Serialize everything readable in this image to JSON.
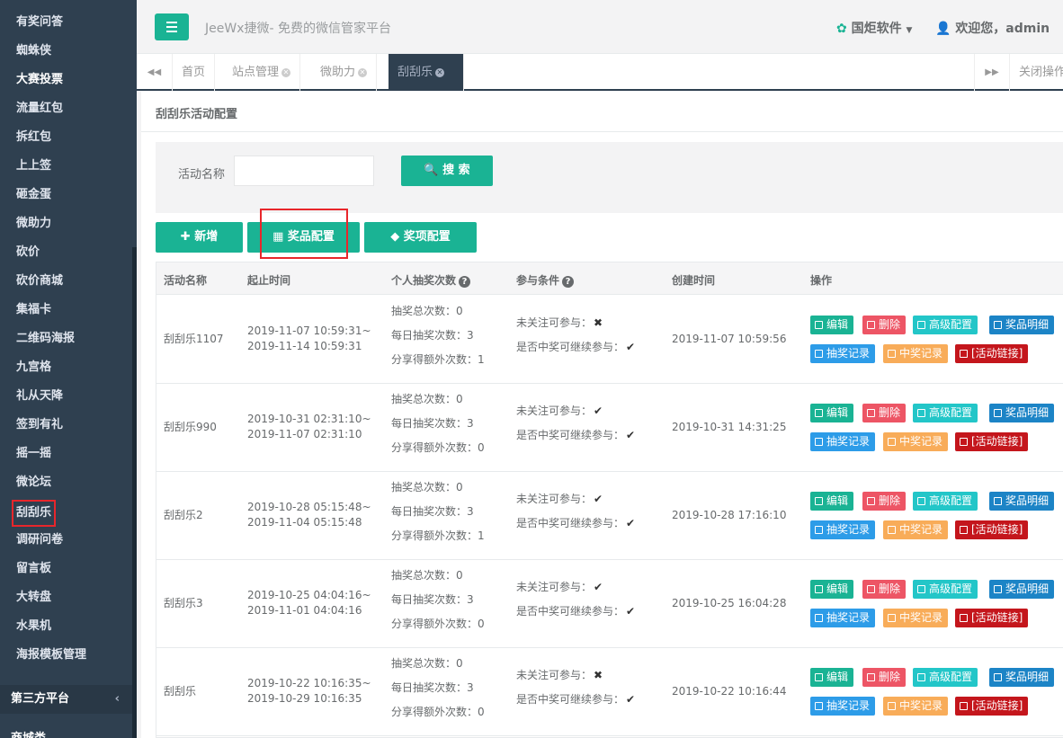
{
  "sidebar": {
    "items": [
      "有奖问答",
      "蜘蛛侠",
      "大赛投票",
      "流量红包",
      "拆红包",
      "上上签",
      "砸金蛋",
      "微助力",
      "砍价",
      "砍价商城",
      "集福卡",
      "二维码海报",
      "九宫格",
      "礼从天降",
      "签到有礼",
      "摇一摇",
      "微论坛",
      "刮刮乐",
      "调研问卷",
      "留言板",
      "大转盘",
      "水果机",
      "海报模板管理"
    ],
    "group_label": "第三方平台",
    "group_caret": "‹",
    "next_group_label": "商城类"
  },
  "header": {
    "brand": "JeeWx捷微- 免费的微信管家平台",
    "company": "国炬软件",
    "welcome": "欢迎您，admin"
  },
  "tabs": {
    "home": "首页",
    "site": "站点管理",
    "help": "微助力",
    "scratch": "刮刮乐",
    "close_ops": "关闭操作",
    "nav_left": "◀◀",
    "nav_right": "▶▶"
  },
  "page": {
    "title": "刮刮乐活动配置",
    "search_label": "活动名称",
    "search_value": "",
    "search_button": "搜 索",
    "add_button": "新增",
    "prize_config_button": "奖品配置",
    "award_config_button": "奖项配置"
  },
  "table": {
    "headers": [
      "活动名称",
      "起止时间",
      "个人抽奖次数",
      "参与条件",
      "创建时间",
      "操作"
    ],
    "op_labels": [
      "编辑",
      "删除",
      "高级配置",
      "奖品明细",
      "抽奖记录",
      "中奖记录",
      "[活动链接]"
    ],
    "rows": [
      {
        "name": "刮刮乐1107",
        "start": "2019-11-07 10:59:31~",
        "end": "2019-11-14 10:59:31",
        "total": "抽奖总次数：0",
        "daily": "每日抽奖次数：3",
        "share": "分享得额外次数：1",
        "follow": "未关注可参与：",
        "follow_mark": "✖",
        "cont": "是否中奖可继续参与：",
        "cont_mark": "✔",
        "created": "2019-11-07 10:59:56"
      },
      {
        "name": "刮刮乐990",
        "start": "2019-10-31 02:31:10~",
        "end": "2019-11-07 02:31:10",
        "total": "抽奖总次数：0",
        "daily": "每日抽奖次数：3",
        "share": "分享得额外次数：0",
        "follow": "未关注可参与：",
        "follow_mark": "✔",
        "cont": "是否中奖可继续参与：",
        "cont_mark": "✔",
        "created": "2019-10-31 14:31:25"
      },
      {
        "name": "刮刮乐2",
        "start": "2019-10-28 05:15:48~",
        "end": "2019-11-04 05:15:48",
        "total": "抽奖总次数：0",
        "daily": "每日抽奖次数：3",
        "share": "分享得额外次数：1",
        "follow": "未关注可参与：",
        "follow_mark": "✔",
        "cont": "是否中奖可继续参与：",
        "cont_mark": "✔",
        "created": "2019-10-28 17:16:10"
      },
      {
        "name": "刮刮乐3",
        "start": "2019-10-25 04:04:16~",
        "end": "2019-11-01 04:04:16",
        "total": "抽奖总次数：0",
        "daily": "每日抽奖次数：3",
        "share": "分享得额外次数：0",
        "follow": "未关注可参与：",
        "follow_mark": "✔",
        "cont": "是否中奖可继续参与：",
        "cont_mark": "✔",
        "created": "2019-10-25 16:04:28"
      },
      {
        "name": "刮刮乐",
        "start": "2019-10-22 10:16:35~",
        "end": "2019-10-29 10:16:35",
        "total": "抽奖总次数：0",
        "daily": "每日抽奖次数：3",
        "share": "分享得额外次数：0",
        "follow": "未关注可参与：",
        "follow_mark": "✖",
        "cont": "是否中奖可继续参与：",
        "cont_mark": "✔",
        "created": "2019-10-22 10:16:44"
      }
    ]
  },
  "colors": {
    "sidebar_bg": "#2f4050",
    "primary": "#1ab394",
    "edit": "#1ab394",
    "delete": "#ed5565",
    "advanced": "#23c6c8",
    "prize_detail": "#1c84c6",
    "draw_record": "#2d9ce8",
    "win_record": "#f8ac59",
    "link": "#c4161c",
    "highlight_box": "#e8262b"
  }
}
